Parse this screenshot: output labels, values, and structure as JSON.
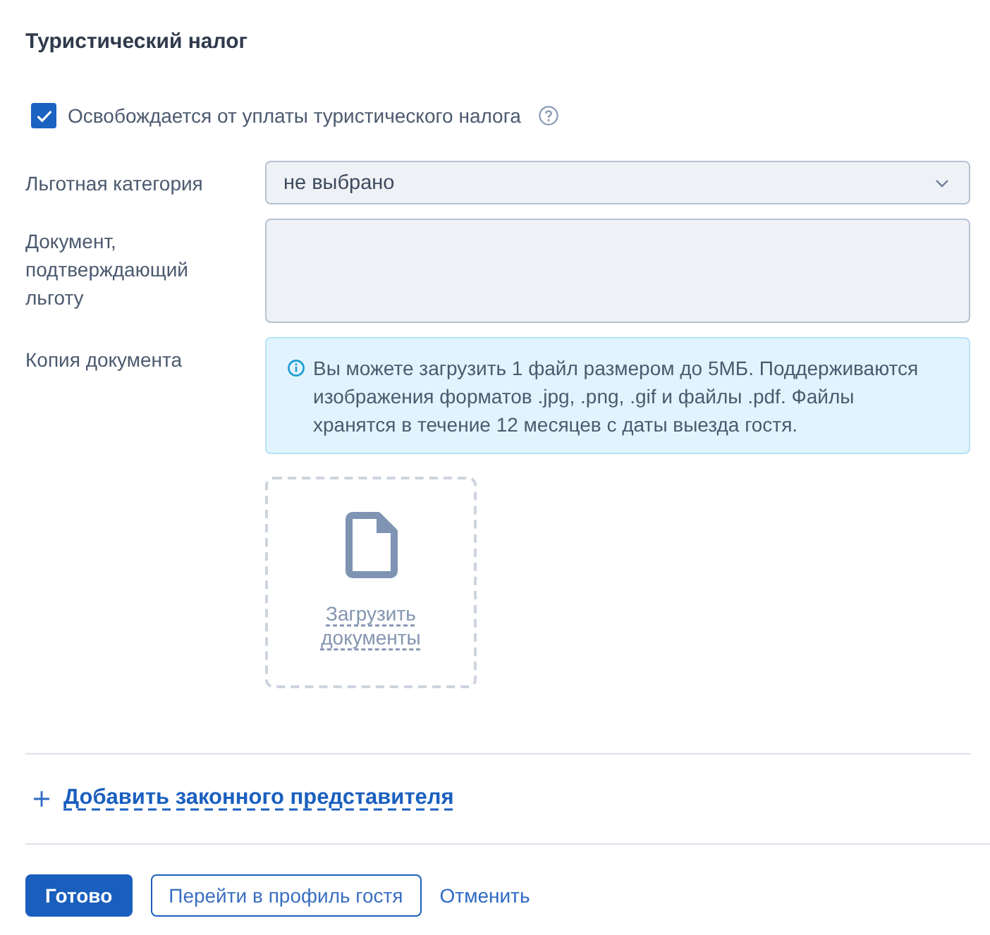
{
  "section": {
    "title": "Туристический налог"
  },
  "exemption": {
    "label": "Освобождается от уплаты туристического налога",
    "checked": true
  },
  "fields": [
    {
      "kind": "select",
      "label": "Льготная категория",
      "value": "не выбрано"
    },
    {
      "kind": "textarea",
      "label": "Документ, подтверждающий льготу"
    }
  ],
  "document_copy": {
    "label": "Копия документа",
    "info": "Вы можете загрузить 1 файл размером до 5МБ. Поддерживаются изображения форматов .jpg, .png, .gif и файлы .pdf. Файлы хранятся в течение 12 месяцев с даты выезда гостя.",
    "upload_label": "Загрузить документы"
  },
  "add_representative": {
    "label": "Добавить законного представителя"
  },
  "buttons": [
    {
      "kind": "primary",
      "label": "Готово"
    },
    {
      "kind": "outline",
      "label": "Перейти в профиль гостя"
    },
    {
      "kind": "link",
      "label": "Отменить"
    }
  ]
}
